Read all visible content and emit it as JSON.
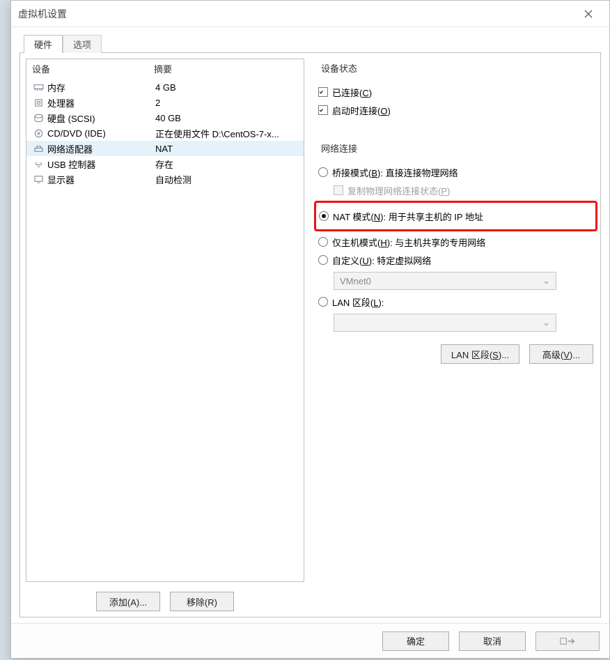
{
  "dialog": {
    "title": "虚拟机设置"
  },
  "tabs": {
    "hardware": "硬件",
    "options": "选项"
  },
  "devices": {
    "headers": {
      "device": "设备",
      "summary": "摘要"
    },
    "items": [
      {
        "icon": "memory",
        "name": "内存",
        "summary": "4 GB"
      },
      {
        "icon": "cpu",
        "name": "处理器",
        "summary": "2"
      },
      {
        "icon": "disk",
        "name": "硬盘 (SCSI)",
        "summary": "40 GB"
      },
      {
        "icon": "cd",
        "name": "CD/DVD (IDE)",
        "summary": "正在使用文件 D:\\CentOS-7-x..."
      },
      {
        "icon": "net",
        "name": "网络适配器",
        "summary": "NAT",
        "selected": true
      },
      {
        "icon": "usb",
        "name": "USB 控制器",
        "summary": "存在"
      },
      {
        "icon": "display",
        "name": "显示器",
        "summary": "自动检测"
      }
    ],
    "add_btn": "添加(A)...",
    "remove_btn": "移除(R)"
  },
  "device_state": {
    "legend": "设备状态",
    "connected": "已连接(C)",
    "connect_at_poweron": "启动时连接(O)"
  },
  "network": {
    "legend": "网络连接",
    "bridged": {
      "label_a": "桥接模式(",
      "key": "B",
      "label_b": "): 直接连接物理网络"
    },
    "replicate": {
      "label_a": "复制物理网络连接状态(",
      "key": "P",
      "label_b": ")"
    },
    "nat": {
      "label_a": "NAT 模式(",
      "key": "N",
      "label_b": "): 用于共享主机的 IP 地址"
    },
    "hostonly": {
      "label_a": "仅主机模式(",
      "key": "H",
      "label_b": "): 与主机共享的专用网络"
    },
    "custom": {
      "label_a": "自定义(",
      "key": "U",
      "label_b": "): 特定虚拟网络"
    },
    "custom_combo": "VMnet0",
    "lan": {
      "label_a": "LAN 区段(",
      "key": "L",
      "label_b": "):"
    },
    "lan_segments_btn": "LAN 区段(S)...",
    "advanced_btn": "高级(V)..."
  },
  "footer": {
    "ok": "确定",
    "cancel": "取消"
  }
}
